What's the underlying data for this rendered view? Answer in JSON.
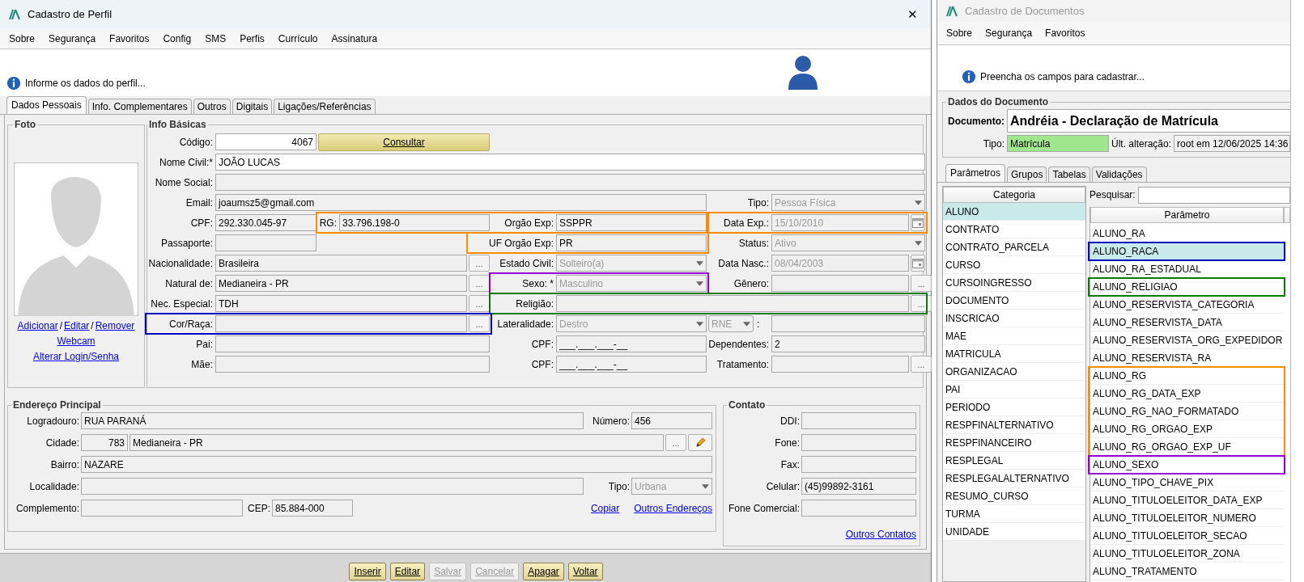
{
  "profile_window": {
    "title": "Cadastro de Perfil",
    "close": "✕",
    "menu": [
      "Sobre",
      "Segurança",
      "Favoritos",
      "Config",
      "SMS",
      "Perfis",
      "Currículo",
      "Assinatura"
    ],
    "info_message": "Informe os dados do perfil...",
    "tabs": [
      {
        "label": "Dados Pessoais",
        "selected": true
      },
      {
        "label": "Info. Complementares",
        "selected": false
      },
      {
        "label": "Outros",
        "selected": false
      },
      {
        "label": "Digitais",
        "selected": false
      },
      {
        "label": "Ligações/Referências",
        "selected": false
      }
    ],
    "foto": {
      "title": "Foto",
      "link_lines": [
        [
          {
            "kind": "link",
            "label": "Adicionar"
          },
          {
            "kind": "text",
            "label": "/"
          },
          {
            "kind": "link",
            "label": "Editar"
          },
          {
            "kind": "text",
            "label": "/"
          },
          {
            "kind": "link",
            "label": "Remover"
          }
        ],
        [
          {
            "kind": "link",
            "label": "Webcam"
          }
        ],
        [
          {
            "kind": "link",
            "label": "Alterar Login/Senha"
          }
        ]
      ]
    },
    "info_basicas": {
      "title": "Info Básicas",
      "codigo": {
        "label": "Código:",
        "value": "4067",
        "editable": true
      },
      "consultar": {
        "label": "Consultar"
      },
      "nome_civil": {
        "label": "Nome Civil:*",
        "value": "JOÃO LUCAS",
        "editable": true
      },
      "nome_social": {
        "label": "Nome Social:"
      },
      "email": {
        "label": "Email:",
        "value": "joaumsz5@gmail.com"
      },
      "tipo": {
        "label": "Tipo:",
        "value": "Pessoa Física",
        "disabled": true
      },
      "cpf": {
        "label": "CPF:",
        "value": "292.330.045-97"
      },
      "rg": {
        "label": "RG:",
        "value": "33.796.198-0"
      },
      "orgao_exp": {
        "label": "Orgão Exp:",
        "value": "SSPPR"
      },
      "data_exp": {
        "label": "Data Exp.:",
        "value": "15/10/2010",
        "disabled": true
      },
      "passaporte": {
        "label": "Passaporte:"
      },
      "uf_orgao_exp": {
        "label": "UF Orgão Exp:",
        "value": "PR"
      },
      "status": {
        "label": "Status:",
        "value": "Ativo",
        "disabled": true
      },
      "nacionalidade": {
        "label": "Nacionalidade:",
        "value": "Brasileira",
        "button": "..."
      },
      "estado_civil": {
        "label": "Estado Civil:",
        "value": "Solteiro(a)",
        "disabled": true
      },
      "data_nasc": {
        "label": "Data Nasc.:",
        "value": "08/04/2003",
        "disabled": true
      },
      "natural_de": {
        "label": "Natural de:",
        "value": "Medianeira - PR",
        "button": "..."
      },
      "sexo": {
        "label": "Sexo: *",
        "value": "Masculino",
        "disabled": true
      },
      "genero": {
        "label": "Gênero:",
        "button": "..."
      },
      "nec_especial": {
        "label": "Nec. Especial:",
        "value": "TDH",
        "button": "..."
      },
      "religiao": {
        "label": "Religião:",
        "button": "..."
      },
      "cor_raca": {
        "label": "Cor/Raça:",
        "button": "..."
      },
      "lateralidade": {
        "label": "Lateralidade:",
        "value": "Destro",
        "disabled": true
      },
      "documento_extra": {
        "selector": "RNE",
        "label": ":",
        "disabled": true
      },
      "pai": {
        "label": "Pai:"
      },
      "cpf_pai": {
        "label": "CPF:",
        "value": "___.___.___-__"
      },
      "dependentes": {
        "label": "Dependentes:",
        "value": "2"
      },
      "mae": {
        "label": "Mãe:"
      },
      "cpf_mae": {
        "label": "CPF:",
        "value": "___.___.___-__"
      },
      "tratamento": {
        "label": "Tratamento:",
        "button": "..."
      },
      "highlights": [
        {
          "color": "#ff8c00"
        },
        {
          "color": "#ff8c00"
        },
        {
          "color": "#ff8c00"
        },
        {
          "color": "#9400d3"
        },
        {
          "color": "#0a7a0a"
        },
        {
          "color": "#0000c0"
        }
      ]
    },
    "endereco": {
      "title": "Endereço Principal",
      "logradouro": {
        "label": "Logradouro:",
        "value": "RUA PARANÁ"
      },
      "numero": {
        "label": "Número:",
        "value": "456"
      },
      "cidade": {
        "label": "Cidade:",
        "code": "783",
        "value": "Medianeira - PR",
        "button": "..."
      },
      "bairro": {
        "label": "Bairro:",
        "value": "NAZARE"
      },
      "localidade": {
        "label": "Localidade:"
      },
      "tipo": {
        "label": "Tipo:",
        "value": "Urbana",
        "disabled": true
      },
      "complemento": {
        "label": "Complemento:"
      },
      "cep": {
        "label": "CEP:",
        "value": "85.884-000"
      },
      "links": [
        "Copiar",
        "Outros Endereços"
      ]
    },
    "contato": {
      "title": "Contato",
      "fields": [
        {
          "label": "DDI:"
        },
        {
          "label": "Fone:"
        },
        {
          "label": "Fax:"
        },
        {
          "label": "Celular:",
          "value": "(45)99892-3161"
        },
        {
          "label": "Fone Comercial:"
        }
      ],
      "link": "Outros Contatos"
    },
    "buttons": [
      {
        "label": "Inserir",
        "disabled": false
      },
      {
        "label": "Editar",
        "disabled": false
      },
      {
        "label": "Salvar",
        "disabled": true
      },
      {
        "label": "Cancelar",
        "disabled": true
      },
      {
        "label": "Apagar",
        "disabled": false
      },
      {
        "label": "Voltar",
        "disabled": false
      }
    ]
  },
  "documents_window": {
    "title": "Cadastro de Documentos",
    "menu": [
      "Sobre",
      "Segurança",
      "Favoritos"
    ],
    "info_message": "Preencha os campos para cadastrar...",
    "section_title": "Dados do Documento",
    "documento": {
      "label": "Documento:",
      "value": "Andréia - Declaração de Matrícula"
    },
    "tipo": {
      "label": "Tipo:",
      "value": "Matrícula"
    },
    "ultima_alteracao": {
      "label": "Últ. alteração:",
      "value": "root em 12/06/2025 14:36"
    },
    "tabs": [
      {
        "label": "Parâmetros",
        "selected": true
      },
      {
        "label": "Grupos",
        "selected": false
      },
      {
        "label": "Tabelas",
        "selected": false
      },
      {
        "label": "Validações",
        "selected": false
      }
    ],
    "categorias": {
      "header": "Categoria",
      "rows": [
        {
          "label": "ALUNO",
          "selected": true
        },
        {
          "label": "CONTRATO",
          "selected": false
        },
        {
          "label": "CONTRATO_PARCELA",
          "selected": false
        },
        {
          "label": "CURSO",
          "selected": false
        },
        {
          "label": "CURSOINGRESSO",
          "selected": false
        },
        {
          "label": "DOCUMENTO",
          "selected": false
        },
        {
          "label": "INSCRICAO",
          "selected": false
        },
        {
          "label": "MAE",
          "selected": false
        },
        {
          "label": "MATRICULA",
          "selected": false
        },
        {
          "label": "ORGANIZACAO",
          "selected": false
        },
        {
          "label": "PAI",
          "selected": false
        },
        {
          "label": "PERIODO",
          "selected": false
        },
        {
          "label": "RESPFINALTERNATIVO",
          "selected": false
        },
        {
          "label": "RESPFINANCEIRO",
          "selected": false
        },
        {
          "label": "RESPLEGAL",
          "selected": false
        },
        {
          "label": "RESPLEGALALTERNATIVO",
          "selected": false
        },
        {
          "label": "RESUMO_CURSO",
          "selected": false
        },
        {
          "label": "TURMA",
          "selected": false
        },
        {
          "label": "UNIDADE",
          "selected": false
        }
      ]
    },
    "search": {
      "label": "Pesquisar:"
    },
    "parametros": {
      "header": "Parâmetro",
      "rows": [
        {
          "label": "ALUNO_RA",
          "selected": false
        },
        {
          "label": "ALUNO_RACA",
          "selected": true,
          "color": "#0000c0"
        },
        {
          "label": "ALUNO_RA_ESTADUAL",
          "selected": false
        },
        {
          "label": "ALUNO_RELIGIAO",
          "selected": false,
          "color": "#0a7a0a"
        },
        {
          "label": "ALUNO_RESERVISTA_CATEGORIA",
          "selected": false
        },
        {
          "label": "ALUNO_RESERVISTA_DATA",
          "selected": false
        },
        {
          "label": "ALUNO_RESERVISTA_ORG_EXPEDIDOR",
          "selected": false
        },
        {
          "label": "ALUNO_RESERVISTA_RA",
          "selected": false
        },
        {
          "label": "ALUNO_RG",
          "selected": false,
          "color": "#ff8c00"
        },
        {
          "label": "ALUNO_RG_DATA_EXP",
          "selected": false,
          "color": "#ff8c00"
        },
        {
          "label": "ALUNO_RG_NAO_FORMATADO",
          "selected": false,
          "color": "#ff8c00"
        },
        {
          "label": "ALUNO_RG_ORGAO_EXP",
          "selected": false,
          "color": "#ff8c00"
        },
        {
          "label": "ALUNO_RG_ORGAO_EXP_UF",
          "selected": false,
          "color": "#ff8c00"
        },
        {
          "label": "ALUNO_SEXO",
          "selected": false,
          "color": "#9400d3"
        },
        {
          "label": "ALUNO_TIPO_CHAVE_PIX",
          "selected": false
        },
        {
          "label": "ALUNO_TITULOELEITOR_DATA_EXP",
          "selected": false
        },
        {
          "label": "ALUNO_TITULOELEITOR_NUMERO",
          "selected": false
        },
        {
          "label": "ALUNO_TITULOELEITOR_SECAO",
          "selected": false
        },
        {
          "label": "ALUNO_TITULOELEITOR_ZONA",
          "selected": false
        },
        {
          "label": "ALUNO_TRATAMENTO",
          "selected": false
        }
      ]
    }
  }
}
